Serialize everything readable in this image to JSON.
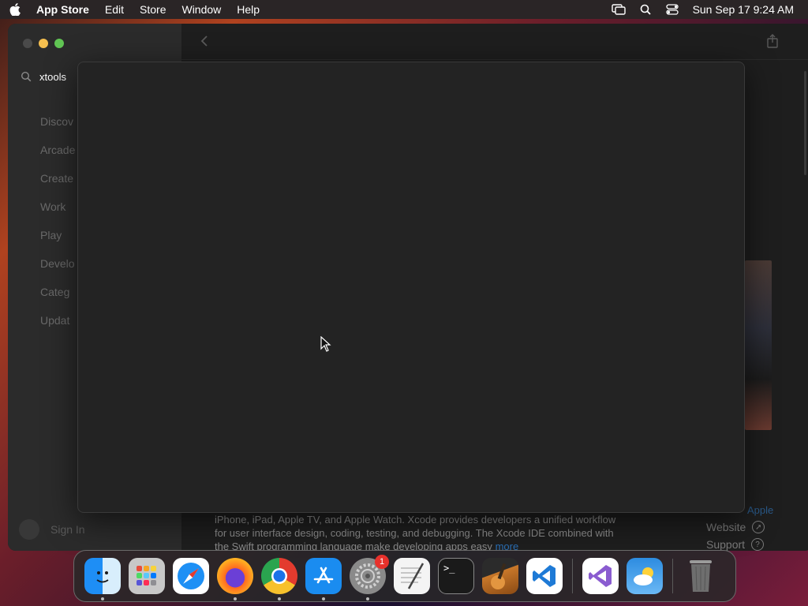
{
  "menubar": {
    "app_name": "App Store",
    "menus": [
      "Edit",
      "Store",
      "Window",
      "Help"
    ],
    "clock": "Sun Sep 17  9:24 AM"
  },
  "sidebar": {
    "search_value": "xtools",
    "items": [
      "Discov",
      "Arcade",
      "Create",
      "Work",
      "Play",
      "Develo",
      "Categ",
      "Updat"
    ],
    "signin": "Sign In"
  },
  "main": {
    "description": "iPhone, iPad, Apple TV, and Apple Watch. Xcode provides developers a unified workflow for user interface design, coding, testing, and debugging. The Xcode IDE combined with the Swift programming language make developing apps easy",
    "more": "more",
    "apple_link": "Apple",
    "website": "Website",
    "support": "Support"
  },
  "dock": {
    "settings_badge": "1",
    "terminal_prompt": ">_"
  },
  "colors": {
    "menubar_bg": "#2a2526",
    "sheet_bg": "#232323",
    "accent": "#2a6fb5"
  }
}
